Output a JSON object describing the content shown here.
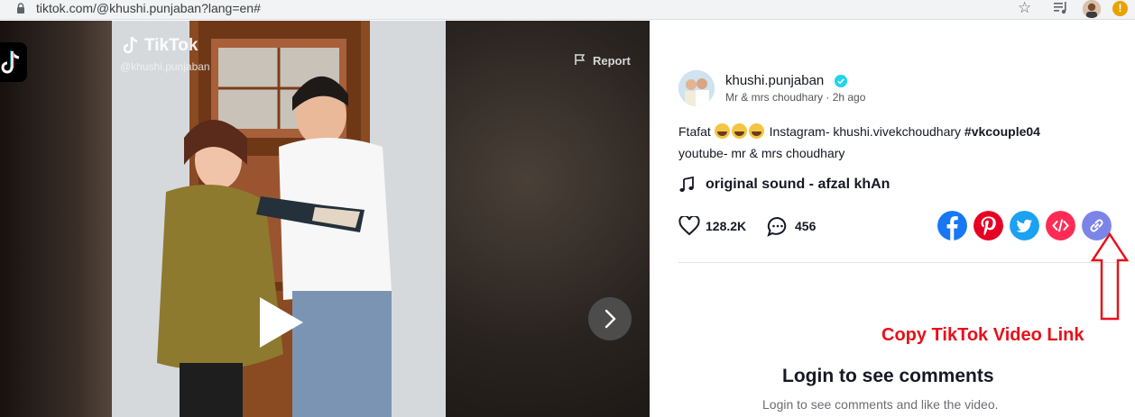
{
  "browser": {
    "url": "tiktok.com/@khushi.punjaban?lang=en#"
  },
  "video": {
    "watermark_brand": "TikTok",
    "watermark_user": "@khushi.punjaban",
    "report_label": "Report"
  },
  "post": {
    "username": "khushi.punjaban",
    "meta": "Mr & mrs choudhary · 2h ago",
    "caption_start": "Ftafat",
    "caption_mid": "Instagram- khushi.vivekchoudhary",
    "hashtag": "#vkcouple04",
    "caption_line2": "youtube- mr & mrs choudhary",
    "sound": "original sound - afzal khAn",
    "likes": "128.2K",
    "comments": "456"
  },
  "share": {
    "colors": {
      "facebook": "#1877f2",
      "pinterest": "#e60023",
      "twitter": "#1da1f2",
      "embed": "#fe2c55",
      "link": "#7d84e8"
    }
  },
  "annotation": {
    "text": "Copy TikTok Video Link",
    "color": "#e8101a"
  },
  "comments_section": {
    "title": "Login to see comments",
    "subtitle": "Login to see comments and like the video."
  }
}
